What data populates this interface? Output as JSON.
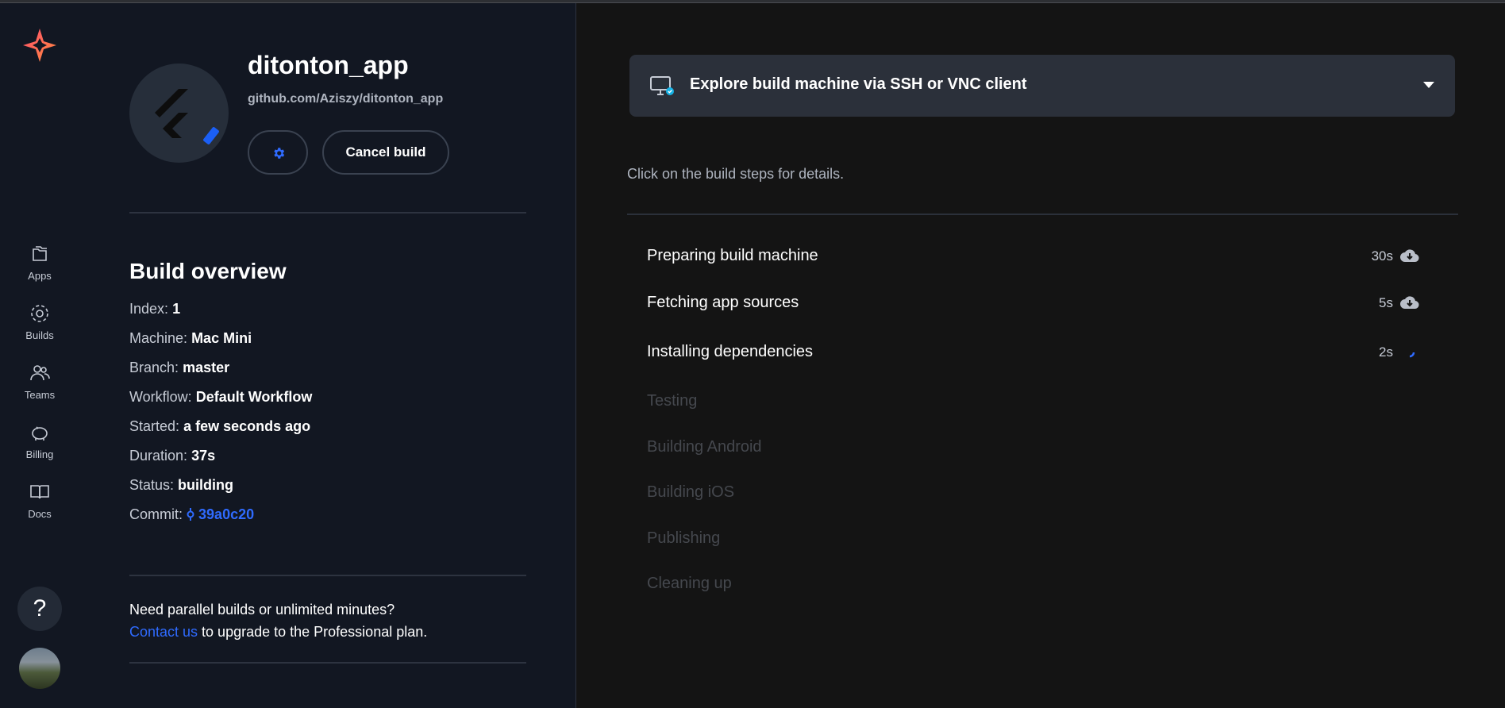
{
  "sidebar": {
    "items": [
      {
        "label": "Apps"
      },
      {
        "label": "Builds"
      },
      {
        "label": "Teams"
      },
      {
        "label": "Billing"
      },
      {
        "label": "Docs"
      }
    ],
    "help_label": "?"
  },
  "app": {
    "name": "ditonton_app",
    "repo": "github.com/Aziszy/ditonton_app",
    "cancel_label": "Cancel build"
  },
  "overview": {
    "title": "Build overview",
    "rows": [
      {
        "label": "Index:",
        "value": "1"
      },
      {
        "label": "Machine:",
        "value": "Mac Mini"
      },
      {
        "label": "Branch:",
        "value": "master"
      },
      {
        "label": "Workflow:",
        "value": "Default Workflow"
      },
      {
        "label": "Started:",
        "value": "a few seconds ago"
      },
      {
        "label": "Duration:",
        "value": "37s"
      },
      {
        "label": "Status:",
        "value": "building"
      }
    ],
    "commit_label": "Commit:",
    "commit_hash": "39a0c20"
  },
  "upgrade": {
    "line1": "Need parallel builds or unlimited minutes?",
    "link": "Contact us",
    "line2": " to upgrade to the Professional plan."
  },
  "explore": {
    "label": "Explore build machine via SSH or VNC client"
  },
  "hint": "Click on the build steps for details.",
  "steps": [
    {
      "name": "Preparing build machine",
      "duration": "30s",
      "state": "done"
    },
    {
      "name": "Fetching app sources",
      "duration": "5s",
      "state": "done"
    },
    {
      "name": "Installing dependencies",
      "duration": "2s",
      "state": "running"
    },
    {
      "name": "Testing",
      "duration": "",
      "state": "pending"
    },
    {
      "name": "Building Android",
      "duration": "",
      "state": "pending"
    },
    {
      "name": "Building iOS",
      "duration": "",
      "state": "pending"
    },
    {
      "name": "Publishing",
      "duration": "",
      "state": "pending"
    },
    {
      "name": "Cleaning up",
      "duration": "",
      "state": "pending"
    }
  ],
  "colors": {
    "accent": "#2f6bff",
    "background": "#141414",
    "panel": "#121722"
  },
  "icons": [
    "codemagic-logo-icon",
    "folder-icon",
    "builds-icon",
    "teams-icon",
    "piggy-bank-icon",
    "book-icon",
    "gear-icon",
    "monitor-icon",
    "cloud-download-icon",
    "spinner-icon",
    "commit-icon"
  ]
}
